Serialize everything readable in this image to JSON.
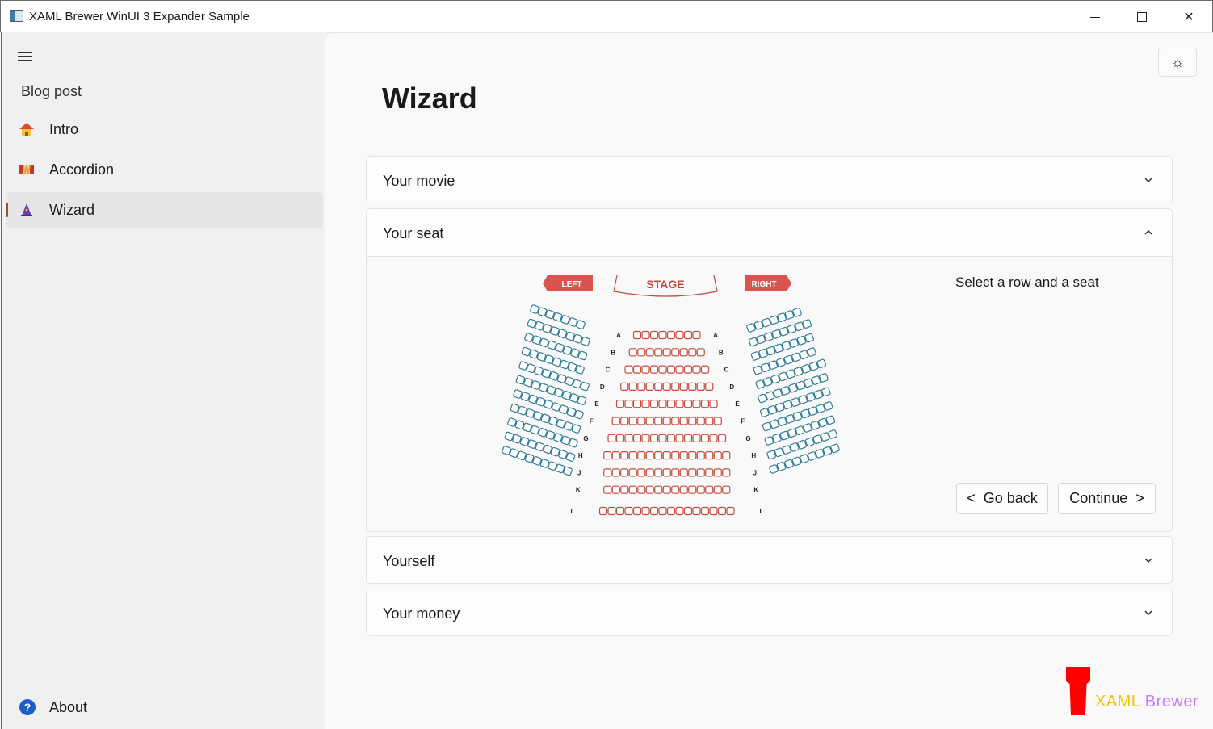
{
  "window": {
    "title": "XAML Brewer WinUI 3 Expander Sample"
  },
  "sidebar": {
    "header": "Blog post",
    "items": [
      {
        "label": "Intro",
        "icon": "house-icon"
      },
      {
        "label": "Accordion",
        "icon": "accordion-icon"
      },
      {
        "label": "Wizard",
        "icon": "wizard-icon",
        "selected": true
      }
    ],
    "footer": {
      "label": "About",
      "icon": "help-icon"
    }
  },
  "page": {
    "title": "Wizard"
  },
  "expanders": [
    {
      "title": "Your movie",
      "expanded": false
    },
    {
      "title": "Your seat",
      "expanded": true,
      "hint": "Select a row and a seat",
      "back_label": "Go back",
      "continue_label": "Continue"
    },
    {
      "title": "Yourself",
      "expanded": false
    },
    {
      "title": "Your money",
      "expanded": false
    }
  ],
  "seatmap": {
    "left_label": "LEFT",
    "stage_label": "STAGE",
    "right_label": "RIGHT",
    "rows": [
      "A",
      "B",
      "C",
      "D",
      "E",
      "F",
      "G",
      "H",
      "J",
      "K",
      "L"
    ],
    "colors": {
      "center": "#c84a3c",
      "sides": "#2e7d9a"
    }
  },
  "logo": {
    "text_a": "XAML",
    "text_b": "Brewer"
  }
}
